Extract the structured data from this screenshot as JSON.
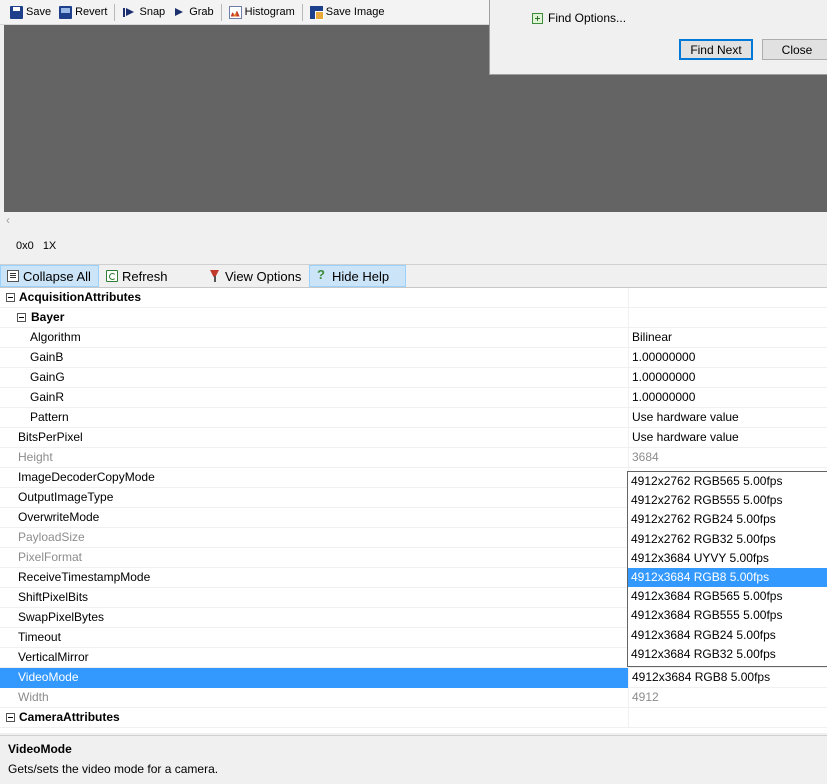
{
  "toolbar": {
    "save": "Save",
    "revert": "Revert",
    "snap": "Snap",
    "grab": "Grab",
    "histogram": "Histogram",
    "save_image": "Save Image"
  },
  "status": {
    "coords": "0x0",
    "zoom": "1X"
  },
  "find_dialog": {
    "options_label": "Find Options...",
    "find_next": "Find Next",
    "close": "Close"
  },
  "pg_toolbar": {
    "collapse_all": "Collapse All",
    "refresh": "Refresh",
    "view_options": "View Options",
    "hide_help": "Hide Help"
  },
  "grid": {
    "rows": [
      {
        "name": "AcquisitionAttributes",
        "value": "",
        "kind": "category",
        "level": 1
      },
      {
        "name": "Bayer",
        "value": "",
        "kind": "category",
        "level": 2
      },
      {
        "name": "Algorithm",
        "value": "Bilinear",
        "kind": "prop",
        "level": 2
      },
      {
        "name": "GainB",
        "value": "1.00000000",
        "kind": "prop",
        "level": 2
      },
      {
        "name": "GainG",
        "value": "1.00000000",
        "kind": "prop",
        "level": 2
      },
      {
        "name": "GainR",
        "value": "1.00000000",
        "kind": "prop",
        "level": 2
      },
      {
        "name": "Pattern",
        "value": "Use hardware value",
        "kind": "prop",
        "level": 2
      },
      {
        "name": "BitsPerPixel",
        "value": "Use hardware value",
        "kind": "prop",
        "level": 1
      },
      {
        "name": "Height",
        "value": "3684",
        "kind": "disabled",
        "level": 1
      },
      {
        "name": "ImageDecoderCopyMode",
        "value": "",
        "kind": "prop",
        "level": 1
      },
      {
        "name": "OutputImageType",
        "value": "",
        "kind": "prop",
        "level": 1
      },
      {
        "name": "OverwriteMode",
        "value": "",
        "kind": "prop",
        "level": 1
      },
      {
        "name": "PayloadSize",
        "value": "",
        "kind": "disabled",
        "level": 1
      },
      {
        "name": "PixelFormat",
        "value": "",
        "kind": "disabled",
        "level": 1
      },
      {
        "name": "ReceiveTimestampMode",
        "value": "",
        "kind": "prop",
        "level": 1
      },
      {
        "name": "ShiftPixelBits",
        "value": "",
        "kind": "prop",
        "level": 1
      },
      {
        "name": "SwapPixelBytes",
        "value": "",
        "kind": "prop",
        "level": 1
      },
      {
        "name": "Timeout",
        "value": "",
        "kind": "prop",
        "level": 1
      },
      {
        "name": "VerticalMirror",
        "value": "",
        "kind": "prop",
        "level": 1
      },
      {
        "name": "VideoMode",
        "value": "4912x3684 RGB8 5.00fps",
        "kind": "selected",
        "level": 1
      },
      {
        "name": "Width",
        "value": "4912",
        "kind": "disabled",
        "level": 1
      },
      {
        "name": "CameraAttributes",
        "value": "",
        "kind": "category",
        "level": 1
      }
    ]
  },
  "dropdown": {
    "options": [
      "4912x2762 RGB565 5.00fps",
      "4912x2762 RGB555 5.00fps",
      "4912x2762 RGB24 5.00fps",
      "4912x2762 RGB32 5.00fps",
      "4912x3684 UYVY 5.00fps",
      "4912x3684 RGB8 5.00fps",
      "4912x3684 RGB565 5.00fps",
      "4912x3684 RGB555 5.00fps",
      "4912x3684 RGB24 5.00fps",
      "4912x3684 RGB32 5.00fps"
    ],
    "selected_index": 5
  },
  "help": {
    "title": "VideoMode",
    "description": "Gets/sets the video mode for a camera."
  },
  "colors": {
    "selection": "#3399ff",
    "canvas": "#646464",
    "disabled_text": "#8c8c8c"
  }
}
